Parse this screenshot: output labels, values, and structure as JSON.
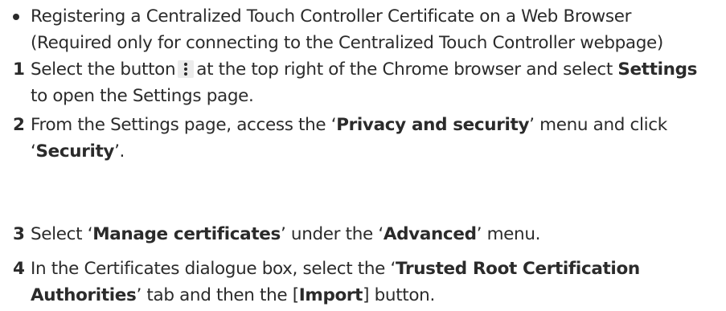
{
  "intro": {
    "line1": "Registering a Centralized Touch Controller Certificate on a Web Browser",
    "line2": "(Required only for connecting to the Centralized Touch Controller webpage)"
  },
  "steps": [
    {
      "number": "1",
      "a": "Select the button",
      "b": "at the top right of the Chrome browser and select",
      "bold1": "Settings",
      "c": "to open the Settings page."
    },
    {
      "number": "2",
      "a": "From the Settings page, access the ‘",
      "bold1": "Privacy and security",
      "b": "’ menu and click",
      "c": "‘",
      "bold2": "Security",
      "d": "’."
    },
    {
      "number": "3",
      "a": "Select ‘",
      "bold1": "Manage certificates",
      "b": "’ under the ‘",
      "bold2": "Advanced",
      "c": "’ menu."
    },
    {
      "number": "4",
      "a": "In the Certificates dialogue box, select the ‘",
      "bold1": "Trusted Root Certification",
      "bold2": "Authorities",
      "b": "’ tab and then the [",
      "bold3": "Import",
      "c": "] button."
    }
  ],
  "icons": {
    "menu_button": "more-vert-icon"
  }
}
